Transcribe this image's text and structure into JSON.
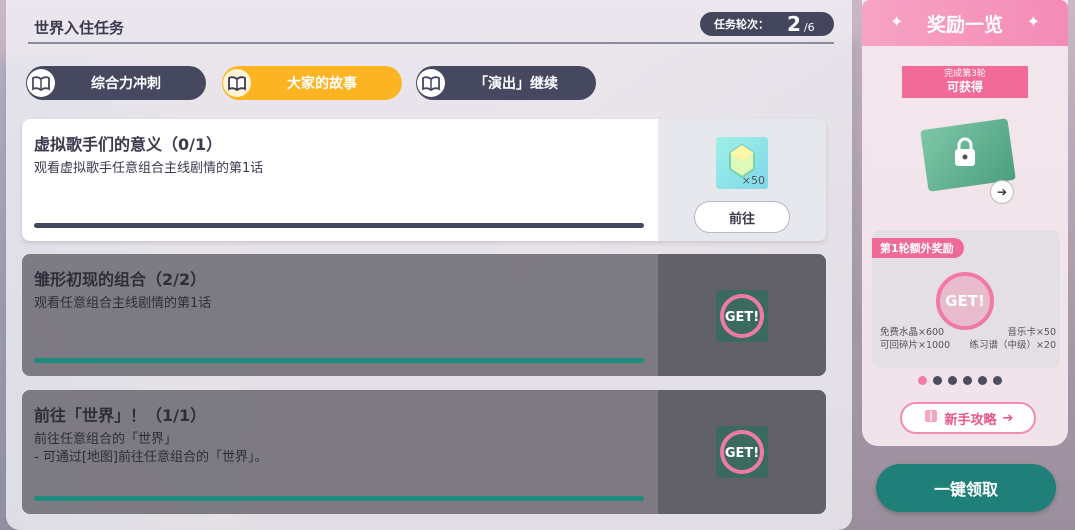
{
  "header": {
    "title": "世界入住任务",
    "round_label": "任务轮次：",
    "round_current": "2",
    "round_total": "/6"
  },
  "tabs": [
    {
      "label": "综合力冲刺",
      "icon": "book-icon",
      "active": false
    },
    {
      "label": "大家的故事",
      "icon": "book-icon",
      "active": true
    },
    {
      "label": "「演出」继续",
      "icon": "book-icon",
      "active": false
    }
  ],
  "tasks": [
    {
      "title": "虚拟歌手们的意义（0/1）",
      "description": "观看虚拟歌手任意组合主线剧情的第1话",
      "reward_count": "×50",
      "button_label": "前往",
      "status": "in-progress",
      "progress": 0
    },
    {
      "title": "雏形初现的组合（2/2）",
      "description": "观看任意组合主线剧情的第1话",
      "badge": "GET!",
      "status": "completed",
      "progress": 1
    },
    {
      "title": "前往「世界」！（1/1）",
      "description_line1": "前往任意组合的「世界」",
      "description_line2": "- 可通过[地图]前往任意组合的「世界」。",
      "badge": "GET!",
      "status": "completed",
      "progress": 1
    }
  ],
  "reward_panel": {
    "title": "奖励一览",
    "ribbon_line1": "完成第3轮",
    "ribbon_line2": "可获得",
    "bonus_tag": "第1轮额外奖励",
    "bonus_badge": "GET!",
    "bonus_items": [
      {
        "left": "免费水晶×600",
        "right": "音乐卡×50"
      },
      {
        "left": "可回碎片×1000",
        "right": "练习谱（中级）×20"
      }
    ],
    "page_dots": 6,
    "page_active": 0,
    "guide_label": "新手攻略"
  },
  "claim_all_label": "一键领取",
  "colors": {
    "accent_pink": "#f48bb6",
    "tab_active": "#fcb423",
    "tab_inactive": "#46485f",
    "progress_done": "#1f8a7e",
    "claim_button": "#1f7f79"
  }
}
